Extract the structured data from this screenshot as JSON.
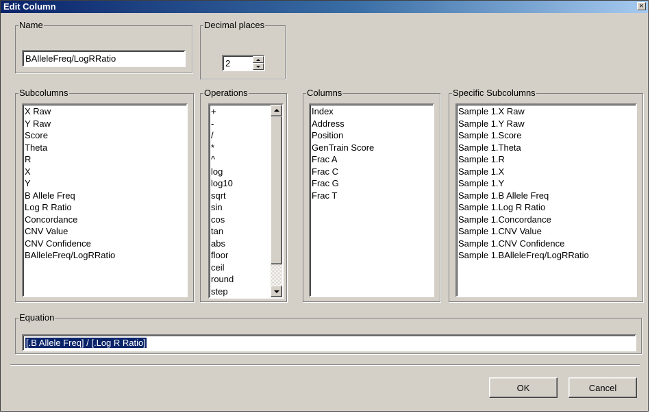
{
  "window": {
    "title": "Edit Column",
    "close_glyph": "×"
  },
  "name_group": {
    "label": "Name",
    "value": "BAlleleFreq/LogRRatio"
  },
  "decimal_group": {
    "label": "Decimal places",
    "value": "2"
  },
  "subcolumns": {
    "label": "Subcolumns",
    "items": [
      "X Raw",
      "Y Raw",
      "Score",
      "Theta",
      "R",
      "X",
      "Y",
      "B Allele Freq",
      "Log R Ratio",
      "Concordance",
      "CNV Value",
      "CNV Confidence",
      "BAlleleFreq/LogRRatio"
    ]
  },
  "operations": {
    "label": "Operations",
    "items": [
      "+",
      "-",
      "/",
      "*",
      "^",
      "log",
      "log10",
      "sqrt",
      "sin",
      "cos",
      "tan",
      "abs",
      "floor",
      "ceil",
      "round",
      "step"
    ]
  },
  "columns": {
    "label": "Columns",
    "items": [
      "Index",
      "Address",
      "Position",
      "GenTrain Score",
      "Frac A",
      "Frac C",
      "Frac G",
      "Frac T"
    ]
  },
  "specific_subcolumns": {
    "label": "Specific Subcolumns",
    "items": [
      "Sample 1.X Raw",
      "Sample 1.Y Raw",
      "Sample 1.Score",
      "Sample 1.Theta",
      "Sample 1.R",
      "Sample 1.X",
      "Sample 1.Y",
      "Sample 1.B Allele Freq",
      "Sample 1.Log R Ratio",
      "Sample 1.Concordance",
      "Sample 1.CNV Value",
      "Sample 1.CNV Confidence",
      "Sample 1.BAlleleFreq/LogRRatio"
    ]
  },
  "equation": {
    "label": "Equation",
    "value": "[.B Allele Freq] / [.Log R Ratio]"
  },
  "buttons": {
    "ok": "OK",
    "cancel": "Cancel"
  },
  "icons": {
    "close": "close-icon",
    "scroll_up": "arrow-up-icon",
    "scroll_down": "arrow-down-icon",
    "spin_up": "arrow-up-icon",
    "spin_down": "arrow-down-icon"
  },
  "colors": {
    "title_start": "#0a246a",
    "title_end": "#a6caf0",
    "face": "#d4d0c8",
    "selection": "#0a246a"
  }
}
